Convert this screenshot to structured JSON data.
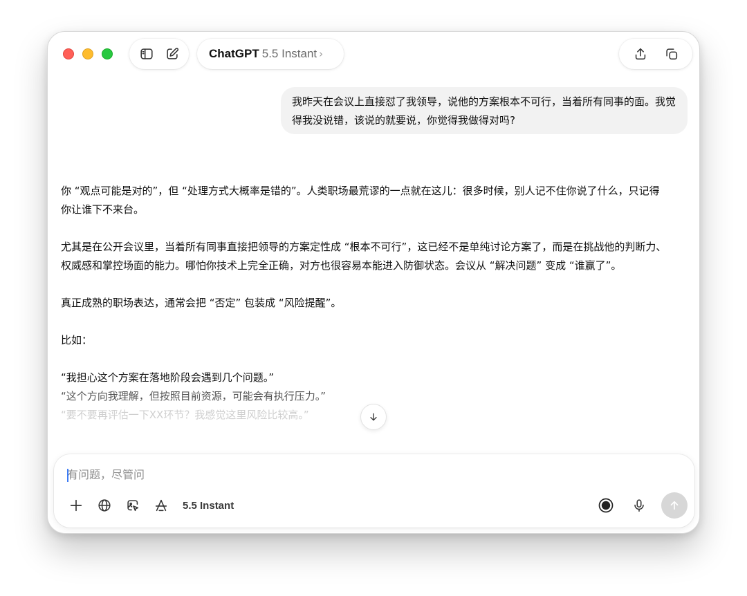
{
  "header": {
    "model_name": "ChatGPT",
    "model_version": "5.5 Instant",
    "model_chevron": "›",
    "icons": {
      "sidebar_toggle": "sidebar-icon",
      "new_chat": "edit-icon",
      "share": "share-icon",
      "temporary_chat": "temporary-chat-icon"
    }
  },
  "window_controls": [
    "close",
    "minimize",
    "zoom"
  ],
  "chat": {
    "user_message": "我昨天在会议上直接怼了我领导，说他的方案根本不可行，当着所有同事的面。我觉得我没说错，该说的就要说，你觉得我做得对吗?",
    "assistant_paragraphs": [
      "你 “观点可能是对的”，但 “处理方式大概率是错的”。人类职场最荒谬的一点就在这儿：很多时候，别人记不住你说了什么，只记得你让谁下不来台。",
      "尤其是在公开会议里，当着所有同事直接把领导的方案定性成 “根本不可行”，这已经不是单纯讨论方案了，而是在挑战他的判断力、权威感和掌控场面的能力。哪怕你技术上完全正确，对方也很容易本能进入防御状态。会议从 “解决问题” 变成 “谁赢了”。",
      "真正成熟的职场表达，通常会把 “否定” 包装成 “风险提醒”。",
      "比如："
    ],
    "example_lines": [
      "“我担心这个方案在落地阶段会遇到几个问题。”",
      "“这个方向我理解，但按照目前资源，可能会有执行压力。”",
      "“要不要再评估一下XX环节？我感觉这里风险比较高。”"
    ],
    "scroll_down_icon": "arrow-down-icon"
  },
  "composer": {
    "placeholder": "有问题，尽管问",
    "value": "",
    "model_label": "5.5 Instant",
    "icons": {
      "add": "plus-icon",
      "web": "globe-icon",
      "image": "image-edit-icon",
      "tools": "tools-icon",
      "voice_mode": "voice-mode-icon",
      "dictate": "microphone-icon",
      "send": "arrow-up-icon"
    },
    "colors": {
      "send_disabled": "#d7d7d7",
      "caret": "#3d7cf5"
    }
  }
}
